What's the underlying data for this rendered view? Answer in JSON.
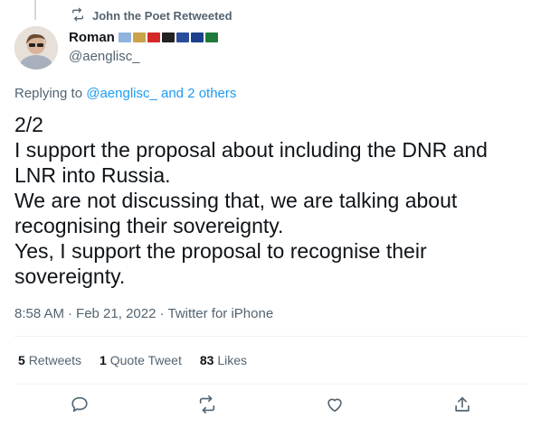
{
  "retweet_banner": {
    "text": "John the Poet Retweeted",
    "icon": "retweet-icon"
  },
  "author": {
    "name": "Roman",
    "handle": "@aenglisc_",
    "flags": [
      "#8fb3dd",
      "#c9a24a",
      "#d62828",
      "#222222",
      "#2a4d9b",
      "#1d3f8c",
      "#1f7a3a"
    ]
  },
  "reply": {
    "prefix": "Replying to",
    "users": "@aenglisc_  and 2 others"
  },
  "tweet": {
    "lines": [
      "2/2",
      "I support the proposal about including the DNR and",
      "LNR into Russia.",
      "We are not discussing that, we are talking about",
      "recognising their sovereignty.",
      "Yes, I support the proposal to recognise their",
      "sovereignty."
    ]
  },
  "meta": {
    "time": "8:58 AM",
    "date": "Feb 21, 2022",
    "source": "Twitter for iPhone"
  },
  "stats": {
    "retweets": {
      "count": "5",
      "label": "Retweets"
    },
    "quotes": {
      "count": "1",
      "label": "Quote Tweet"
    },
    "likes": {
      "count": "83",
      "label": "Likes"
    }
  },
  "actions": [
    "reply-icon",
    "retweet-icon",
    "like-icon",
    "share-icon"
  ],
  "colors": {
    "link": "#1d9bf0",
    "muted": "#536471",
    "text": "#0f1419"
  }
}
